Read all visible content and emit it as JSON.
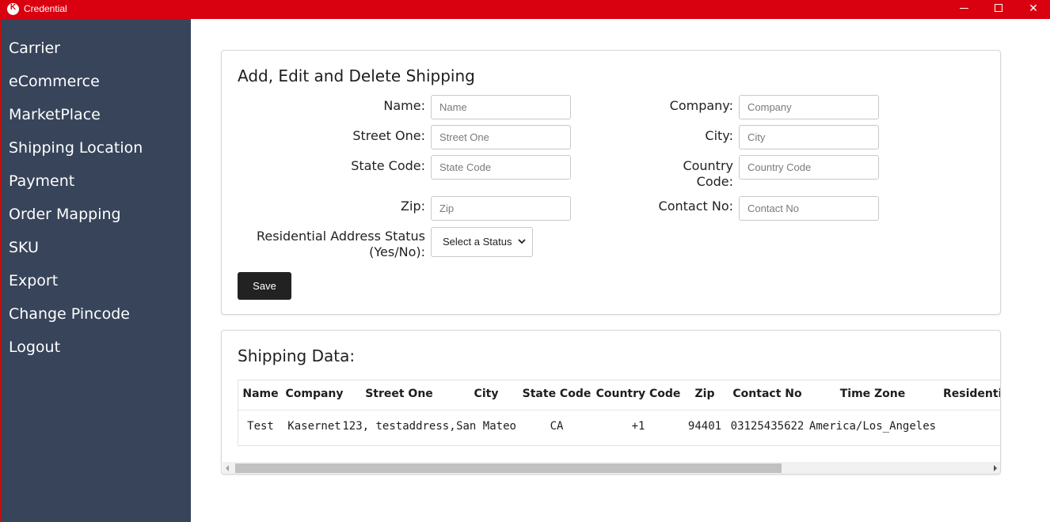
{
  "window": {
    "title": "Credential",
    "icon": "kasernet-logo-icon"
  },
  "sidebar": {
    "items": [
      {
        "label": "Carrier"
      },
      {
        "label": "eCommerce"
      },
      {
        "label": "MarketPlace"
      },
      {
        "label": "Shipping Location"
      },
      {
        "label": "Payment"
      },
      {
        "label": "Order Mapping"
      },
      {
        "label": "SKU"
      },
      {
        "label": "Export"
      },
      {
        "label": "Change Pincode"
      },
      {
        "label": "Logout"
      }
    ]
  },
  "form": {
    "title": "Add, Edit and Delete Shipping",
    "name": {
      "label": "Name:",
      "placeholder": "Name",
      "value": ""
    },
    "company": {
      "label": "Company:",
      "placeholder": "Company",
      "value": ""
    },
    "street_one": {
      "label": "Street One:",
      "placeholder": "Street One",
      "value": ""
    },
    "city": {
      "label": "City:",
      "placeholder": "City",
      "value": ""
    },
    "state_code": {
      "label": "State Code:",
      "placeholder": "State Code",
      "value": ""
    },
    "country_code": {
      "label_line1": "Country",
      "label_line2": "Code:",
      "placeholder": "Country Code",
      "value": ""
    },
    "zip": {
      "label": "Zip:",
      "placeholder": "Zip",
      "value": ""
    },
    "contact_no": {
      "label": "Contact No:",
      "placeholder": "Contact No",
      "value": ""
    },
    "residential": {
      "label_line1": "Residential Address Status",
      "label_line2": "(Yes/No):",
      "selected": "Select a Status"
    },
    "save_label": "Save"
  },
  "table": {
    "title": "Shipping Data:",
    "columns": [
      "Name",
      "Company",
      "Street One",
      "City",
      "State Code",
      "Country Code",
      "Zip",
      "Contact No",
      "Time Zone",
      "Residentia"
    ],
    "rows": [
      [
        "Test",
        "Kasernet",
        "123, testaddress,",
        "San Mateo",
        "CA",
        "+1",
        "94401",
        "03125435622",
        "America/Los_Angeles",
        ""
      ]
    ]
  },
  "colors": {
    "titlebar": "#d9000f",
    "sidebar": "#37445a",
    "save_button": "#222222"
  }
}
